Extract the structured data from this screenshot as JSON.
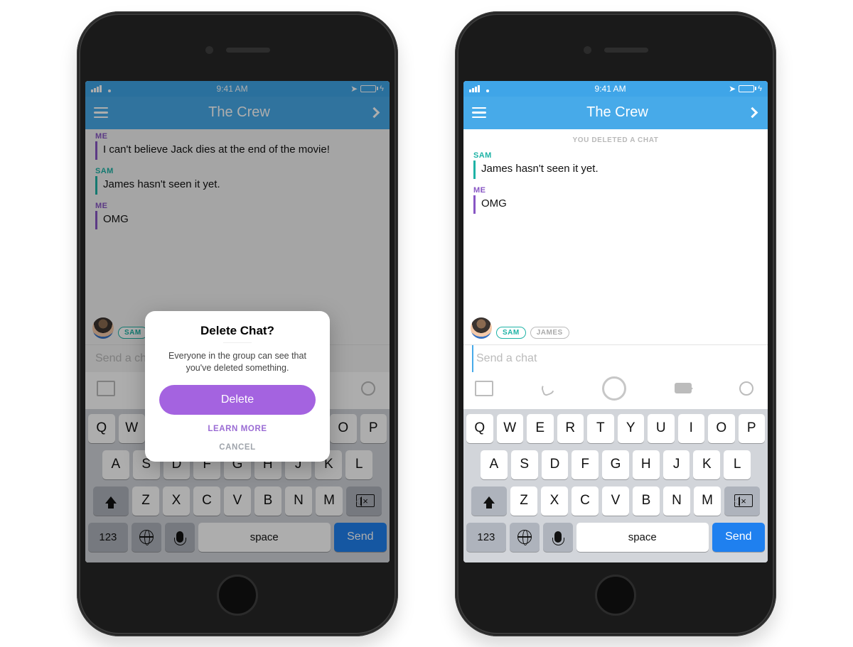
{
  "status": {
    "time": "9:41 AM"
  },
  "header": {
    "title": "The Crew"
  },
  "left": {
    "messages": [
      {
        "label": "ME",
        "text": "I can't believe Jack dies at the end of the movie!",
        "who": "me"
      },
      {
        "label": "SAM",
        "text": "James hasn't seen it yet.",
        "who": "sam"
      },
      {
        "label": "ME",
        "text": "OMG",
        "who": "me"
      }
    ],
    "presence": {
      "pill1": "SAM"
    },
    "compose": {
      "placeholder": "Send a chat"
    },
    "modal": {
      "title": "Delete Chat?",
      "body": "Everyone in the group can see that you've deleted something.",
      "delete": "Delete",
      "learn": "LEARN MORE",
      "cancel": "CANCEL"
    }
  },
  "right": {
    "deleted_notice": "YOU DELETED A CHAT",
    "messages": [
      {
        "label": "SAM",
        "text": "James hasn't seen it yet.",
        "who": "sam"
      },
      {
        "label": "ME",
        "text": "OMG",
        "who": "me"
      }
    ],
    "presence": {
      "pill1": "SAM",
      "pill2": "JAMES"
    },
    "compose": {
      "placeholder": "Send a chat"
    }
  },
  "keyboard": {
    "row1": [
      "Q",
      "W",
      "E",
      "R",
      "T",
      "Y",
      "U",
      "I",
      "O",
      "P"
    ],
    "row2": [
      "A",
      "S",
      "D",
      "F",
      "G",
      "H",
      "J",
      "K",
      "L"
    ],
    "row3": [
      "Z",
      "X",
      "C",
      "V",
      "B",
      "N",
      "M"
    ],
    "k123": "123",
    "space": "space",
    "send": "Send"
  }
}
